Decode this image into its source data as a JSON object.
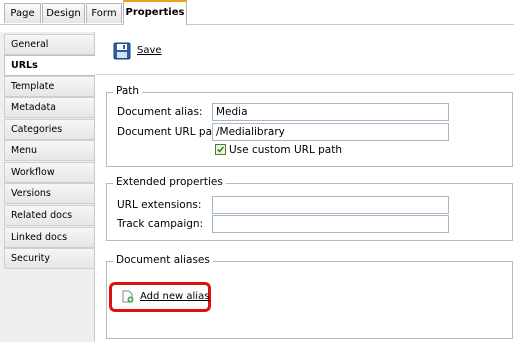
{
  "tabs": [
    {
      "label": "Page"
    },
    {
      "label": "Design"
    },
    {
      "label": "Form"
    },
    {
      "label": "Properties",
      "active": true
    }
  ],
  "sidebar": {
    "items": [
      {
        "label": "General"
      },
      {
        "label": "URLs",
        "active": true
      },
      {
        "label": "Template"
      },
      {
        "label": "Metadata"
      },
      {
        "label": "Categories"
      },
      {
        "label": "Menu"
      },
      {
        "label": "Workflow"
      },
      {
        "label": "Versions"
      },
      {
        "label": "Related docs"
      },
      {
        "label": "Linked docs"
      },
      {
        "label": "Security"
      }
    ]
  },
  "toolbar": {
    "save_label": "Save",
    "save_icon": "floppy-disk-icon"
  },
  "path_section": {
    "legend": "Path",
    "document_alias_label": "Document alias:",
    "document_alias_value": "Media",
    "document_url_path_label": "Document URL path:",
    "document_url_path_value": "/Medialibrary",
    "custom_url_checkbox_label": "Use custom URL path",
    "custom_url_checked": true
  },
  "extended_section": {
    "legend": "Extended properties",
    "url_extensions_label": "URL extensions:",
    "url_extensions_value": "",
    "track_campaign_label": "Track campaign:",
    "track_campaign_value": ""
  },
  "aliases_section": {
    "legend": "Document aliases",
    "add_new_alias_label": "Add new alias",
    "add_icon": "add-document-icon"
  },
  "colors": {
    "active_tab_accent": "#f0a020",
    "highlight": "#e01010",
    "input_border": "#a9b8c9"
  }
}
